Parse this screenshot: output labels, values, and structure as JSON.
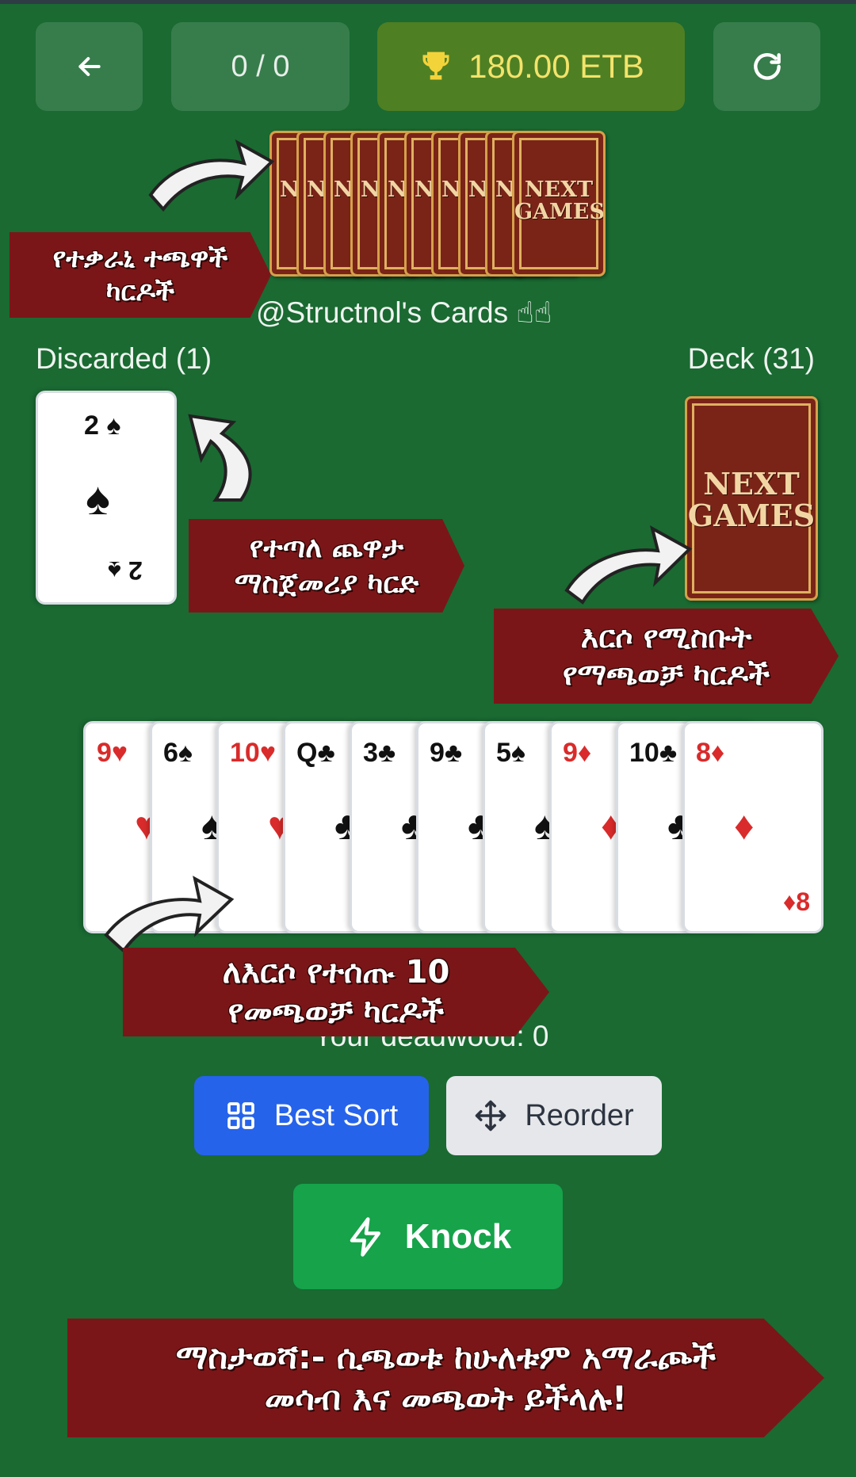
{
  "top_bar": {
    "back_icon": "arrow-left-icon",
    "score": "0 / 0",
    "balance": "180.00 ETB",
    "trophy_icon": "trophy-icon",
    "refresh_icon": "refresh-icon"
  },
  "card_back": {
    "line1": "NEXT",
    "line2": "GAMES",
    "partial": "N G"
  },
  "opponent": {
    "label": "@Structnol's Cards ☝☝"
  },
  "discard": {
    "label": "Discarded (1)",
    "card": {
      "rank": "2",
      "suit": "♠"
    }
  },
  "deck": {
    "label": "Deck (31)"
  },
  "hand": [
    {
      "rank": "9",
      "suit": "♥",
      "color": "red"
    },
    {
      "rank": "6",
      "suit": "♠",
      "color": "black"
    },
    {
      "rank": "10",
      "suit": "♥",
      "color": "red"
    },
    {
      "rank": "Q",
      "suit": "♣",
      "color": "black"
    },
    {
      "rank": "3",
      "suit": "♣",
      "color": "black"
    },
    {
      "rank": "9",
      "suit": "♣",
      "color": "black"
    },
    {
      "rank": "5",
      "suit": "♠",
      "color": "black"
    },
    {
      "rank": "9",
      "suit": "♦",
      "color": "red"
    },
    {
      "rank": "10",
      "suit": "♣",
      "color": "black"
    },
    {
      "rank": "8",
      "suit": "♦",
      "color": "red"
    }
  ],
  "deadwood": "Your deadwood: 0",
  "buttons": {
    "best_sort": "Best Sort",
    "reorder": "Reorder",
    "knock": "Knock"
  },
  "annotations": {
    "opponent_cards": [
      "የተቃራኒ ተጫዋች",
      "ካርዶች"
    ],
    "starting_card": [
      "የተጣለ ጨዋታ",
      "ማስጀመሪያ ካርድ"
    ],
    "draw_cards": [
      "እርሶ የሚስቡት",
      "የማጫወቻ ካርዶች"
    ],
    "your_cards": [
      "ለእርሶ የተሰጡ 10",
      "የመጫወቻ ካርዶች"
    ],
    "tip": [
      "ማስታወሻ:- ሲጫወቱ ከሁለቱም አማራጮች",
      "መሳብ እና መጫወት ይችላሉ!"
    ]
  },
  "colors": {
    "table": "#1a6a32",
    "banner": "#7b1618",
    "best_sort": "#2563eb",
    "knock": "#16a34a"
  }
}
